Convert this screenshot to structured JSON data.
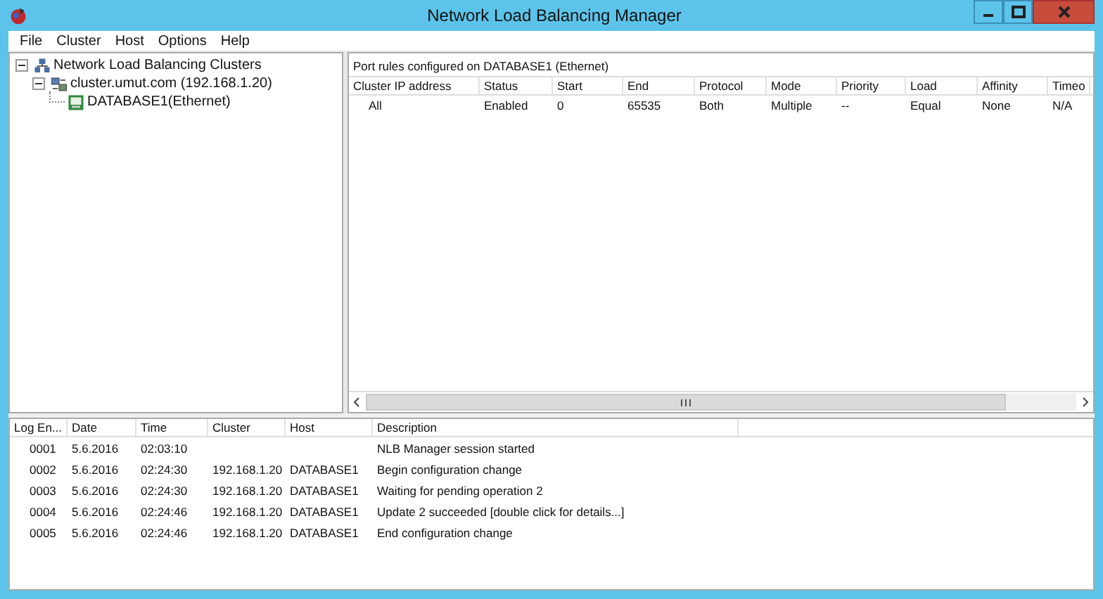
{
  "window": {
    "title": "Network Load Balancing Manager"
  },
  "menu": [
    "File",
    "Cluster",
    "Host",
    "Options",
    "Help"
  ],
  "tree": [
    {
      "label": "Network Load Balancing Clusters",
      "kind": "root",
      "expanded": true,
      "children": [
        {
          "label": "cluster.umut.com (192.168.1.20)",
          "kind": "cluster",
          "expanded": true,
          "children": [
            {
              "label": "DATABASE1(Ethernet)",
              "kind": "host"
            }
          ]
        }
      ]
    }
  ],
  "port_rules": {
    "caption": "Port rules configured on DATABASE1 (Ethernet)",
    "columns": [
      "Cluster IP address",
      "Status",
      "Start",
      "End",
      "Protocol",
      "Mode",
      "Priority",
      "Load",
      "Affinity",
      "Timeo"
    ],
    "rows": [
      [
        "All",
        "Enabled",
        "0",
        "65535",
        "Both",
        "Multiple",
        "--",
        "Equal",
        "None",
        "N/A"
      ]
    ]
  },
  "log": {
    "columns": [
      "Log En...",
      "Date",
      "Time",
      "Cluster",
      "Host",
      "Description"
    ],
    "rows": [
      [
        "0001",
        "5.6.2016",
        "02:03:10",
        "",
        "",
        "NLB Manager session started"
      ],
      [
        "0002",
        "5.6.2016",
        "02:24:30",
        "192.168.1.20",
        "DATABASE1",
        "Begin configuration change"
      ],
      [
        "0003",
        "5.6.2016",
        "02:24:30",
        "192.168.1.20",
        "DATABASE1",
        "Waiting for pending operation 2"
      ],
      [
        "0004",
        "5.6.2016",
        "02:24:46",
        "192.168.1.20",
        "DATABASE1",
        "Update 2 succeeded [double click for details...]"
      ],
      [
        "0005",
        "5.6.2016",
        "02:24:46",
        "192.168.1.20",
        "DATABASE1",
        "End configuration change"
      ]
    ]
  }
}
